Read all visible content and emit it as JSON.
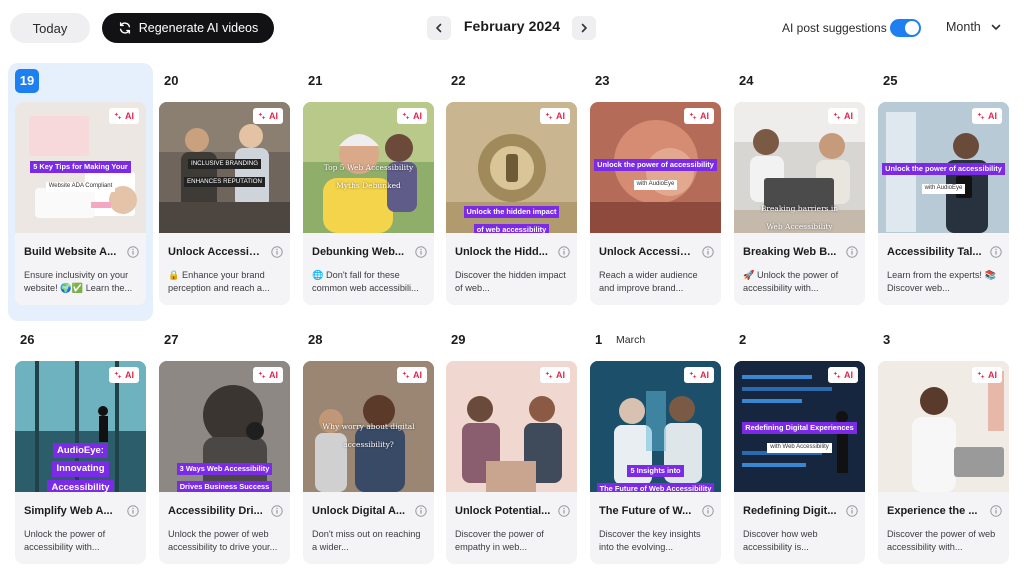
{
  "toolbar": {
    "today_label": "Today",
    "regenerate_label": "Regenerate AI videos",
    "month_label": "February 2024",
    "ai_suggestions_label": "AI post suggestions",
    "ai_suggestions_enabled": true,
    "view_label": "Month"
  },
  "colors": {
    "accent": "#1e7ff0",
    "ai_badge": "#e0294f",
    "overlay_purple": "#7b2be5"
  },
  "badge_label": "AI",
  "days": [
    {
      "num": "19",
      "month": "",
      "title": "Build Website A...",
      "desc": "Ensure inclusivity on your website! 🌍✅ Learn the...",
      "overlay": [
        "5 Key Tips for Making Your",
        "Website ADA Compliant"
      ]
    },
    {
      "num": "20",
      "month": "",
      "title": "Unlock Accessibi...",
      "desc": "🔒 Enhance your brand perception and reach a...",
      "overlay": [
        "INCLUSIVE BRANDING",
        "ENHANCES REPUTATION"
      ]
    },
    {
      "num": "21",
      "month": "",
      "title": "Debunking Web...",
      "desc": "🌐 Don't fall for these common web accessibili...",
      "overlay": [
        "Top 5 Web Accessibility",
        "Myths Debunked"
      ]
    },
    {
      "num": "22",
      "month": "",
      "title": "Unlock the Hidd...",
      "desc": "Discover the hidden impact of web...",
      "overlay": [
        "Unlock the hidden impact",
        "of web accessibility"
      ]
    },
    {
      "num": "23",
      "month": "",
      "title": "Unlock Accessibi...",
      "desc": "Reach a wider audience and improve brand...",
      "overlay": [
        "Unlock the power of accessibility",
        "with AudioEye"
      ]
    },
    {
      "num": "24",
      "month": "",
      "title": "Breaking Web B...",
      "desc": "🚀 Unlock the power of accessibility with...",
      "overlay": [
        "Breaking barriers in",
        "Web Accessibility"
      ]
    },
    {
      "num": "25",
      "month": "",
      "title": "Accessibility Tal...",
      "desc": "Learn from the experts! 📚 Discover web...",
      "overlay": [
        "Unlock the power of accessibility",
        "with AudioEye"
      ]
    },
    {
      "num": "26",
      "month": "",
      "title": "Simplify Web A...",
      "desc": "Unlock the power of accessibility with...",
      "overlay": [
        "AudioEye:",
        "Innovating",
        "Accessibility"
      ]
    },
    {
      "num": "27",
      "month": "",
      "title": "Accessibility Dri...",
      "desc": "Unlock the power of web accessibility to drive your...",
      "overlay": [
        "3 Ways Web Accessibility",
        "Drives Business Success"
      ]
    },
    {
      "num": "28",
      "month": "",
      "title": "Unlock Digital A...",
      "desc": "Don't miss out on reaching a wider...",
      "overlay": [
        "Why worry about digital",
        "accessibility?"
      ]
    },
    {
      "num": "29",
      "month": "",
      "title": "Unlock Potential...",
      "desc": "Discover the power of empathy in web...",
      "overlay": []
    },
    {
      "num": "1",
      "month": "March",
      "title": "The Future of W...",
      "desc": "Discover the key insights into the evolving...",
      "overlay": [
        "5 Insights into",
        "The Future of Web Accessibility"
      ]
    },
    {
      "num": "2",
      "month": "",
      "title": "Redefining Digit...",
      "desc": "Discover how web accessibility is...",
      "overlay": [
        "Redefining Digital Experiences",
        "with Web Accessibility"
      ]
    },
    {
      "num": "3",
      "month": "",
      "title": "Experience the ...",
      "desc": "Discover the power of web accessibility with...",
      "overlay": []
    }
  ]
}
